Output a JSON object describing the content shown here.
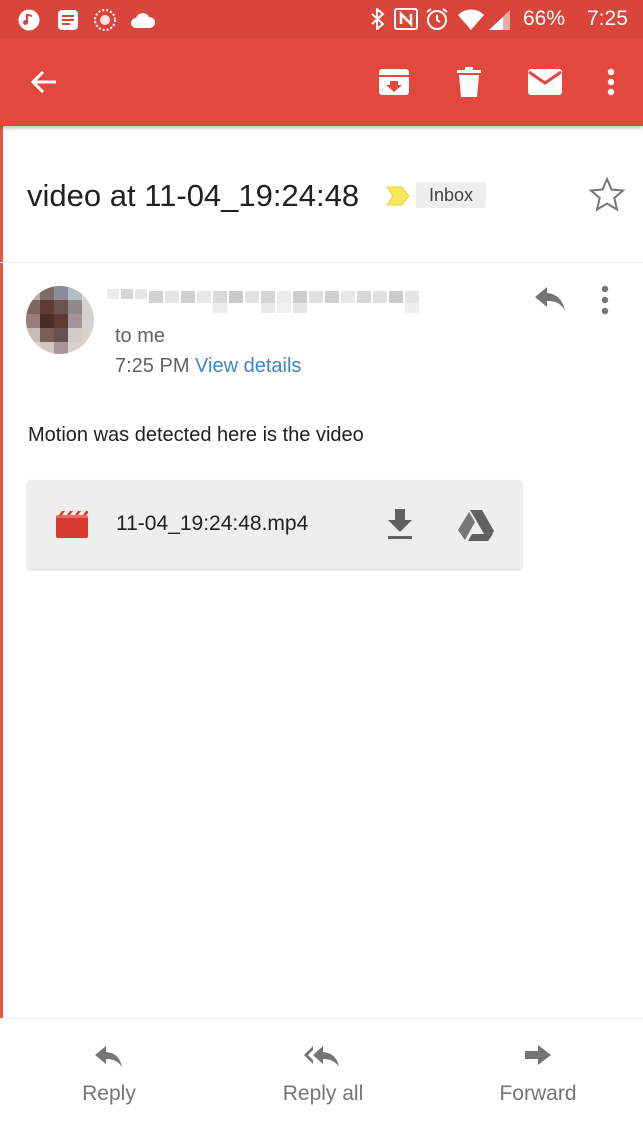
{
  "status_bar": {
    "battery": "66%",
    "time": "7:25",
    "icons": [
      "music-icon",
      "news-icon",
      "dots-icon",
      "cloud-icon",
      "bluetooth-icon",
      "nfc-icon",
      "alarm-icon",
      "wifi-icon",
      "signal-icon"
    ]
  },
  "toolbar": {
    "actions": [
      "back-arrow-icon",
      "archive-icon",
      "delete-icon",
      "mark-unread-icon",
      "more-vert-icon"
    ]
  },
  "email": {
    "subject": "video at 11-04_19:24:48",
    "label": "Inbox",
    "recipient": "to me",
    "time": "7:25 PM",
    "details_link": "View details",
    "body": "Motion was detected here is the video"
  },
  "attachment": {
    "filename": "11-04_19:24:48.mp4"
  },
  "bottom_bar": {
    "reply": "Reply",
    "reply_all": "Reply all",
    "forward": "Forward"
  },
  "colors": {
    "app_bar": "#e3483d",
    "status_bar": "#d9453b",
    "link": "#3d85c6",
    "importance": "#f7e85a",
    "video_icon": "#d93a2f"
  }
}
